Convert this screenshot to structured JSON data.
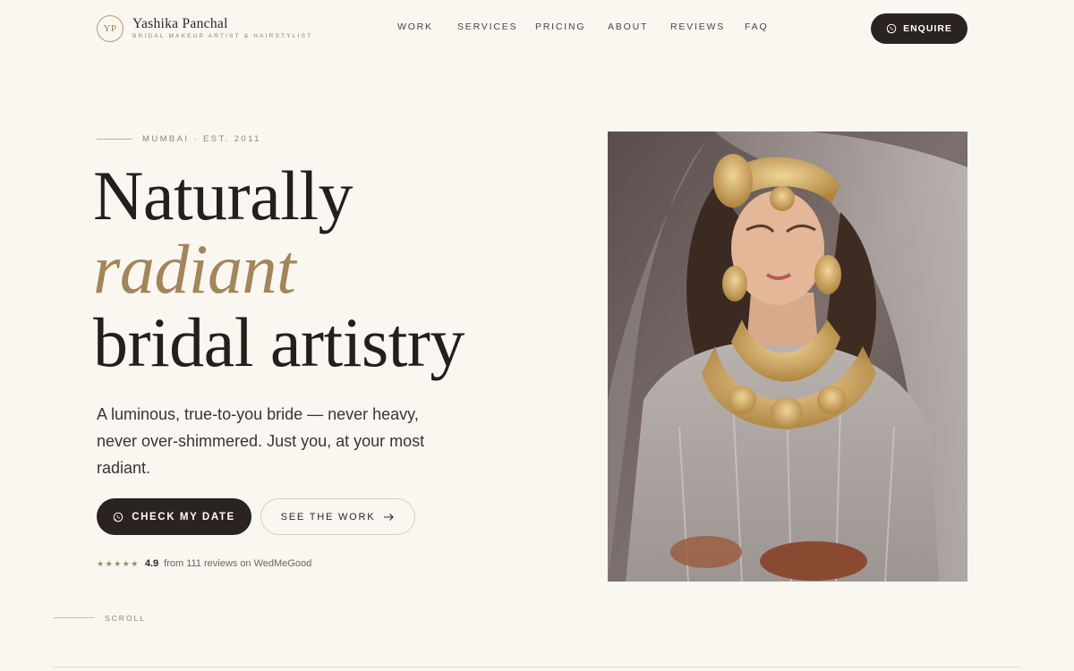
{
  "header": {
    "logo_monogram": "YP",
    "brand_name": "Yashika Panchal",
    "brand_tagline": "BRIDAL MAKEUP ARTIST & HAIRSTYLIST",
    "nav": [
      {
        "label": "WORK"
      },
      {
        "label": "SERVICES"
      },
      {
        "label": "PRICING"
      },
      {
        "label": "ABOUT"
      },
      {
        "label": "REVIEWS"
      },
      {
        "label": "FAQ"
      }
    ],
    "enquire_label": "ENQUIRE",
    "enquire_icon": "whatsapp-icon"
  },
  "hero": {
    "eyebrow": "MUMBAI · EST. 2011",
    "headline_line1": "Naturally",
    "headline_accent": "radiant",
    "headline_line3": "bridal artistry",
    "lede": "A luminous, true-to-you bride — never heavy, never over-shimmered. Just you, at your most radiant.",
    "cta_primary": "CHECK MY DATE",
    "cta_secondary": "SEE THE WORK",
    "rating_stars": 5,
    "rating_score": "4.9",
    "rating_text": "from 111 reviews on WedMeGood",
    "scroll_label": "SCROLL"
  },
  "colors": {
    "background": "#faf6f0",
    "accent_gold": "#a3855a",
    "dark": "#2a2320"
  }
}
